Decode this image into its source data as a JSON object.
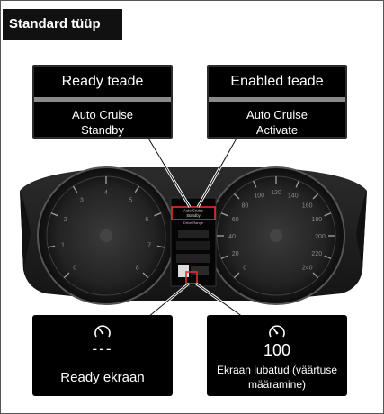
{
  "header": {
    "title": "Standard tüüp"
  },
  "callouts": [
    {
      "title": "Ready teade",
      "line1": "Auto Cruise",
      "line2": "Standby"
    },
    {
      "title": "Enabled teade",
      "line1": "Auto Cruise",
      "line2": "Activate"
    }
  ],
  "cluster": {
    "display_line1": "Auto Cruise",
    "display_line2": "Standby",
    "display_line3": "Drive Range",
    "left_gauge_ticks": [
      "0",
      "1",
      "2",
      "3",
      "4",
      "5",
      "6",
      "7",
      "8"
    ],
    "right_gauge_ticks": [
      "0",
      "20",
      "40",
      "60",
      "80",
      "100",
      "120",
      "140",
      "160",
      "180",
      "200",
      "220",
      "240"
    ]
  },
  "screens": [
    {
      "value": "---",
      "label": "Ready ekraan",
      "icon": "speedometer-icon"
    },
    {
      "value": "100",
      "label": "Ekraan lubatud (väärtuse määramine)",
      "icon": "speedometer-icon"
    }
  ],
  "colors": {
    "highlight": "#e0312b",
    "panel": "#000000",
    "band": "#8a8a8a"
  }
}
